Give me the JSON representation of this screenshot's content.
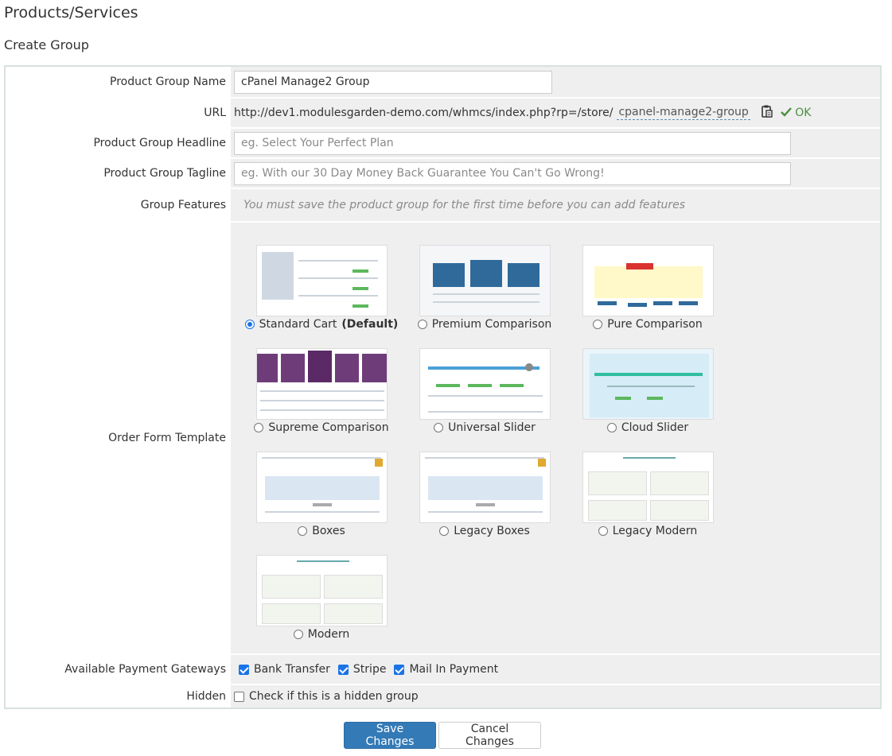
{
  "page": {
    "title": "Products/Services",
    "subtitle": "Create Group"
  },
  "form": {
    "group_name": {
      "label": "Product Group Name",
      "value": "cPanel Manage2 Group"
    },
    "url": {
      "label": "URL",
      "prefix": "http://dev1.modulesgarden-demo.com/whmcs/index.php?rp=/store/",
      "slug": "cpanel-manage2-group",
      "status": "OK"
    },
    "headline": {
      "label": "Product Group Headline",
      "placeholder": "eg. Select Your Perfect Plan"
    },
    "tagline": {
      "label": "Product Group Tagline",
      "placeholder": "eg. With our 30 Day Money Back Guarantee You Can't Go Wrong!"
    },
    "features": {
      "label": "Group Features",
      "hint": "You must save the product group for the first time before you can add features"
    },
    "order_form": {
      "label": "Order Form Template",
      "templates": [
        {
          "name": "Standard Cart",
          "suffix": "(Default)",
          "selected": true
        },
        {
          "name": "Premium Comparison",
          "selected": false
        },
        {
          "name": "Pure Comparison",
          "selected": false
        },
        {
          "name": "Supreme Comparison",
          "selected": false
        },
        {
          "name": "Universal Slider",
          "selected": false
        },
        {
          "name": "Cloud Slider",
          "selected": false
        },
        {
          "name": "Boxes",
          "selected": false
        },
        {
          "name": "Legacy Boxes",
          "selected": false
        },
        {
          "name": "Legacy Modern",
          "selected": false
        },
        {
          "name": "Modern",
          "selected": false
        }
      ]
    },
    "gateways": {
      "label": "Available Payment Gateways",
      "items": [
        {
          "name": "Bank Transfer",
          "checked": true
        },
        {
          "name": "Stripe",
          "checked": true
        },
        {
          "name": "Mail In Payment",
          "checked": true
        }
      ]
    },
    "hidden": {
      "label": "Hidden",
      "text": "Check if this is a hidden group",
      "checked": false
    }
  },
  "buttons": {
    "save": "Save Changes",
    "cancel": "Cancel Changes"
  },
  "colors": {
    "primary": "#337ab7",
    "ok_green": "#4b8f3f",
    "check_blue": "#1a73e8",
    "row_bg": "#efefef"
  }
}
